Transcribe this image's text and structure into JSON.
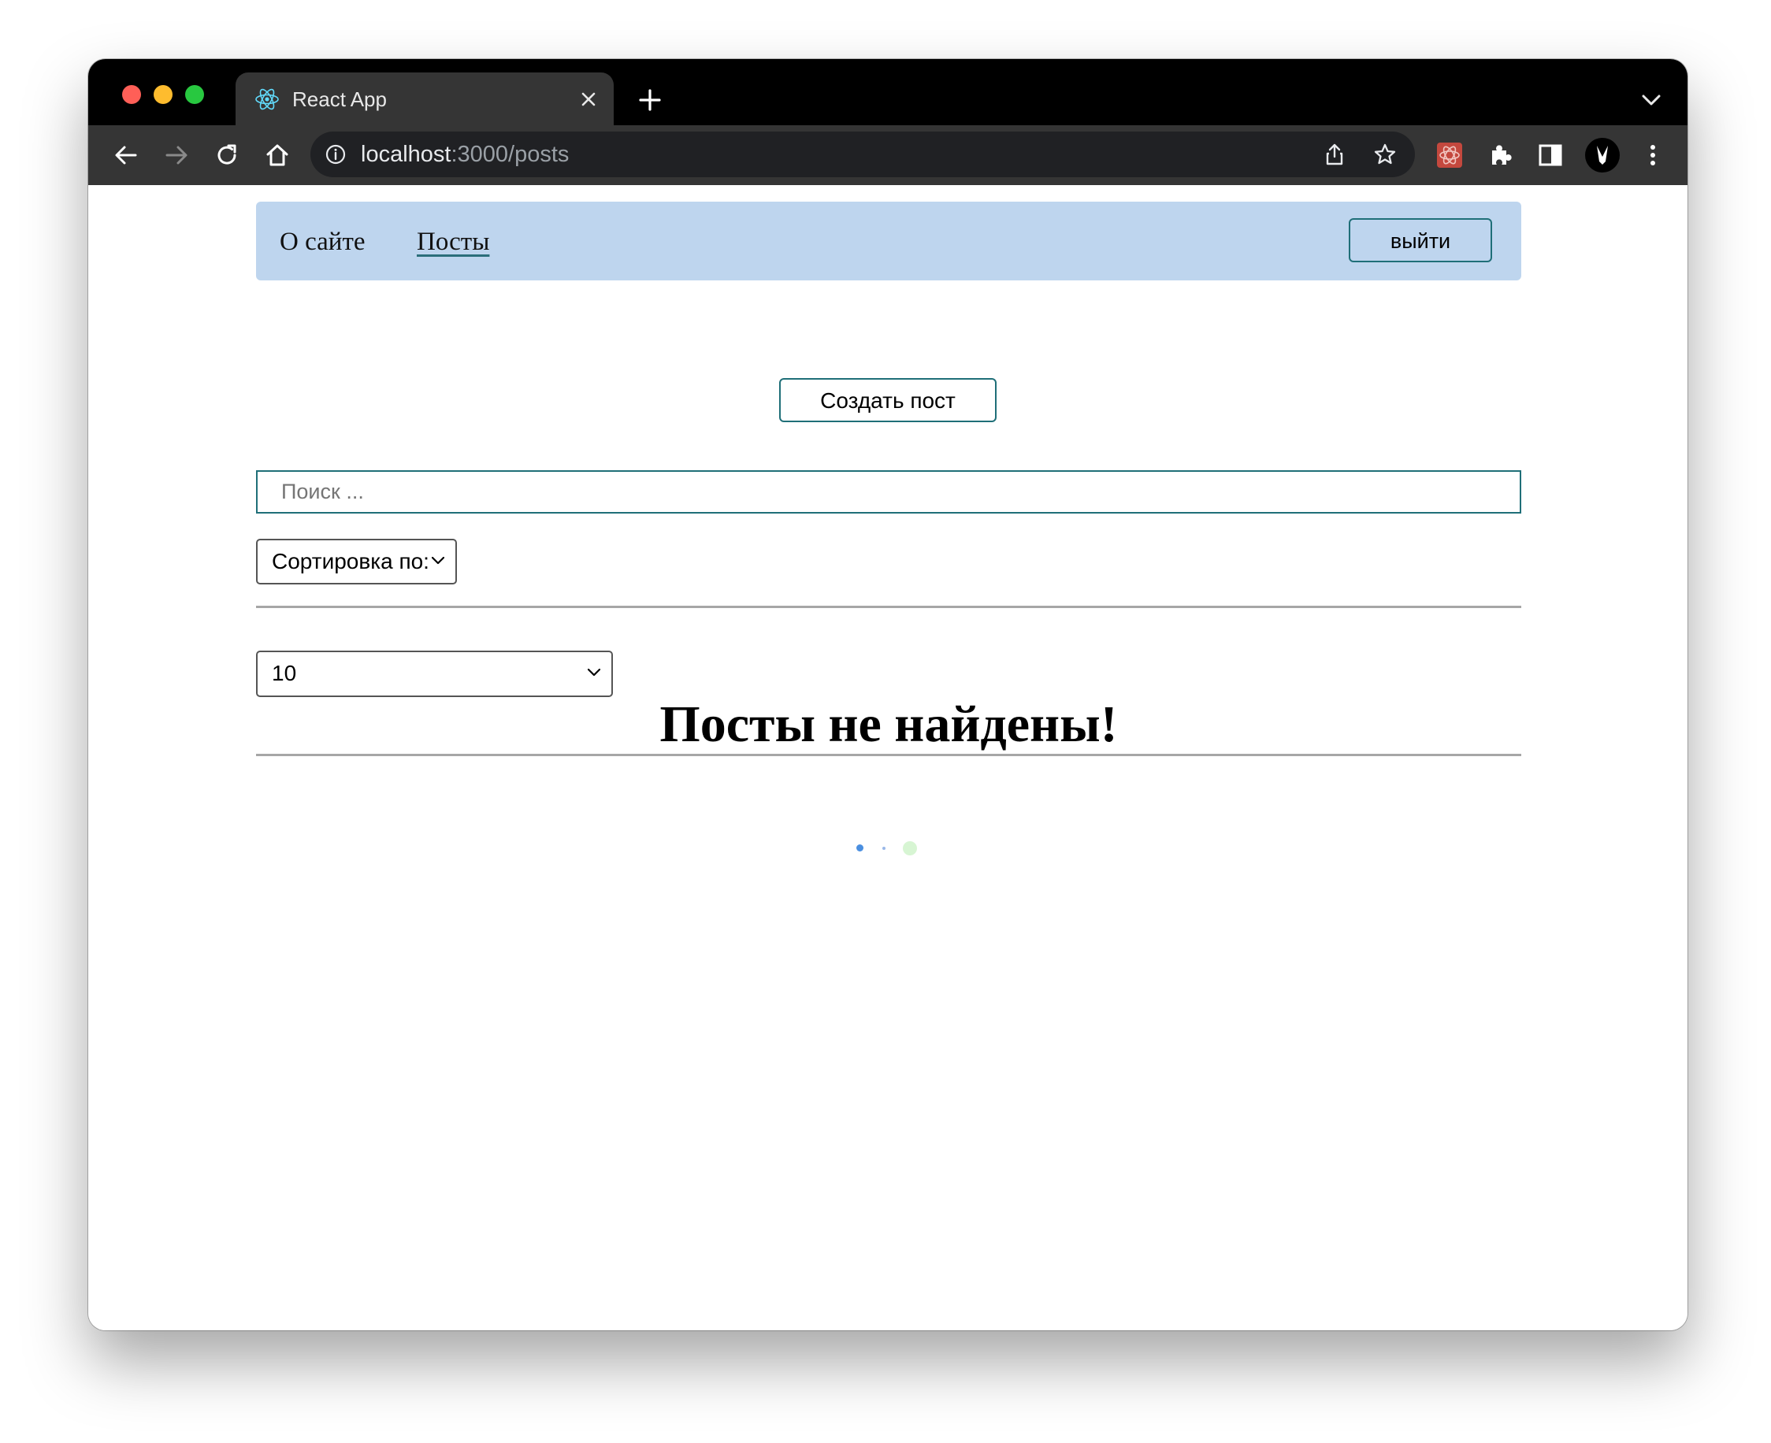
{
  "browser": {
    "tab": {
      "title": "React App",
      "icon": "react-logo-icon"
    },
    "address": {
      "host": "localhost",
      "rest": ":3000/posts"
    },
    "icons": [
      "back-arrow-icon",
      "forward-arrow-icon",
      "reload-icon",
      "home-icon",
      "info-icon",
      "share-icon",
      "star-icon",
      "extension-react-devtools-icon",
      "puzzle-icon",
      "side-panel-icon",
      "profile-avatar-icon",
      "more-menu-icon"
    ]
  },
  "navbar": {
    "links": [
      {
        "label": "О сайте"
      },
      {
        "label": "Посты",
        "active": true
      }
    ],
    "logout_label": "выйти",
    "background": "#bed5ee"
  },
  "create_button": {
    "label": "Создать пост"
  },
  "search": {
    "placeholder": "Поиск ...",
    "value": ""
  },
  "sort_select": {
    "selected": "Сортировка по:"
  },
  "limit_select": {
    "selected": "10"
  },
  "empty_message": "Посты не найдены!",
  "colors": {
    "accent": "#1f6f78",
    "loader_blue": "#4a8fe0",
    "loader_green": "#d7f5d3"
  }
}
